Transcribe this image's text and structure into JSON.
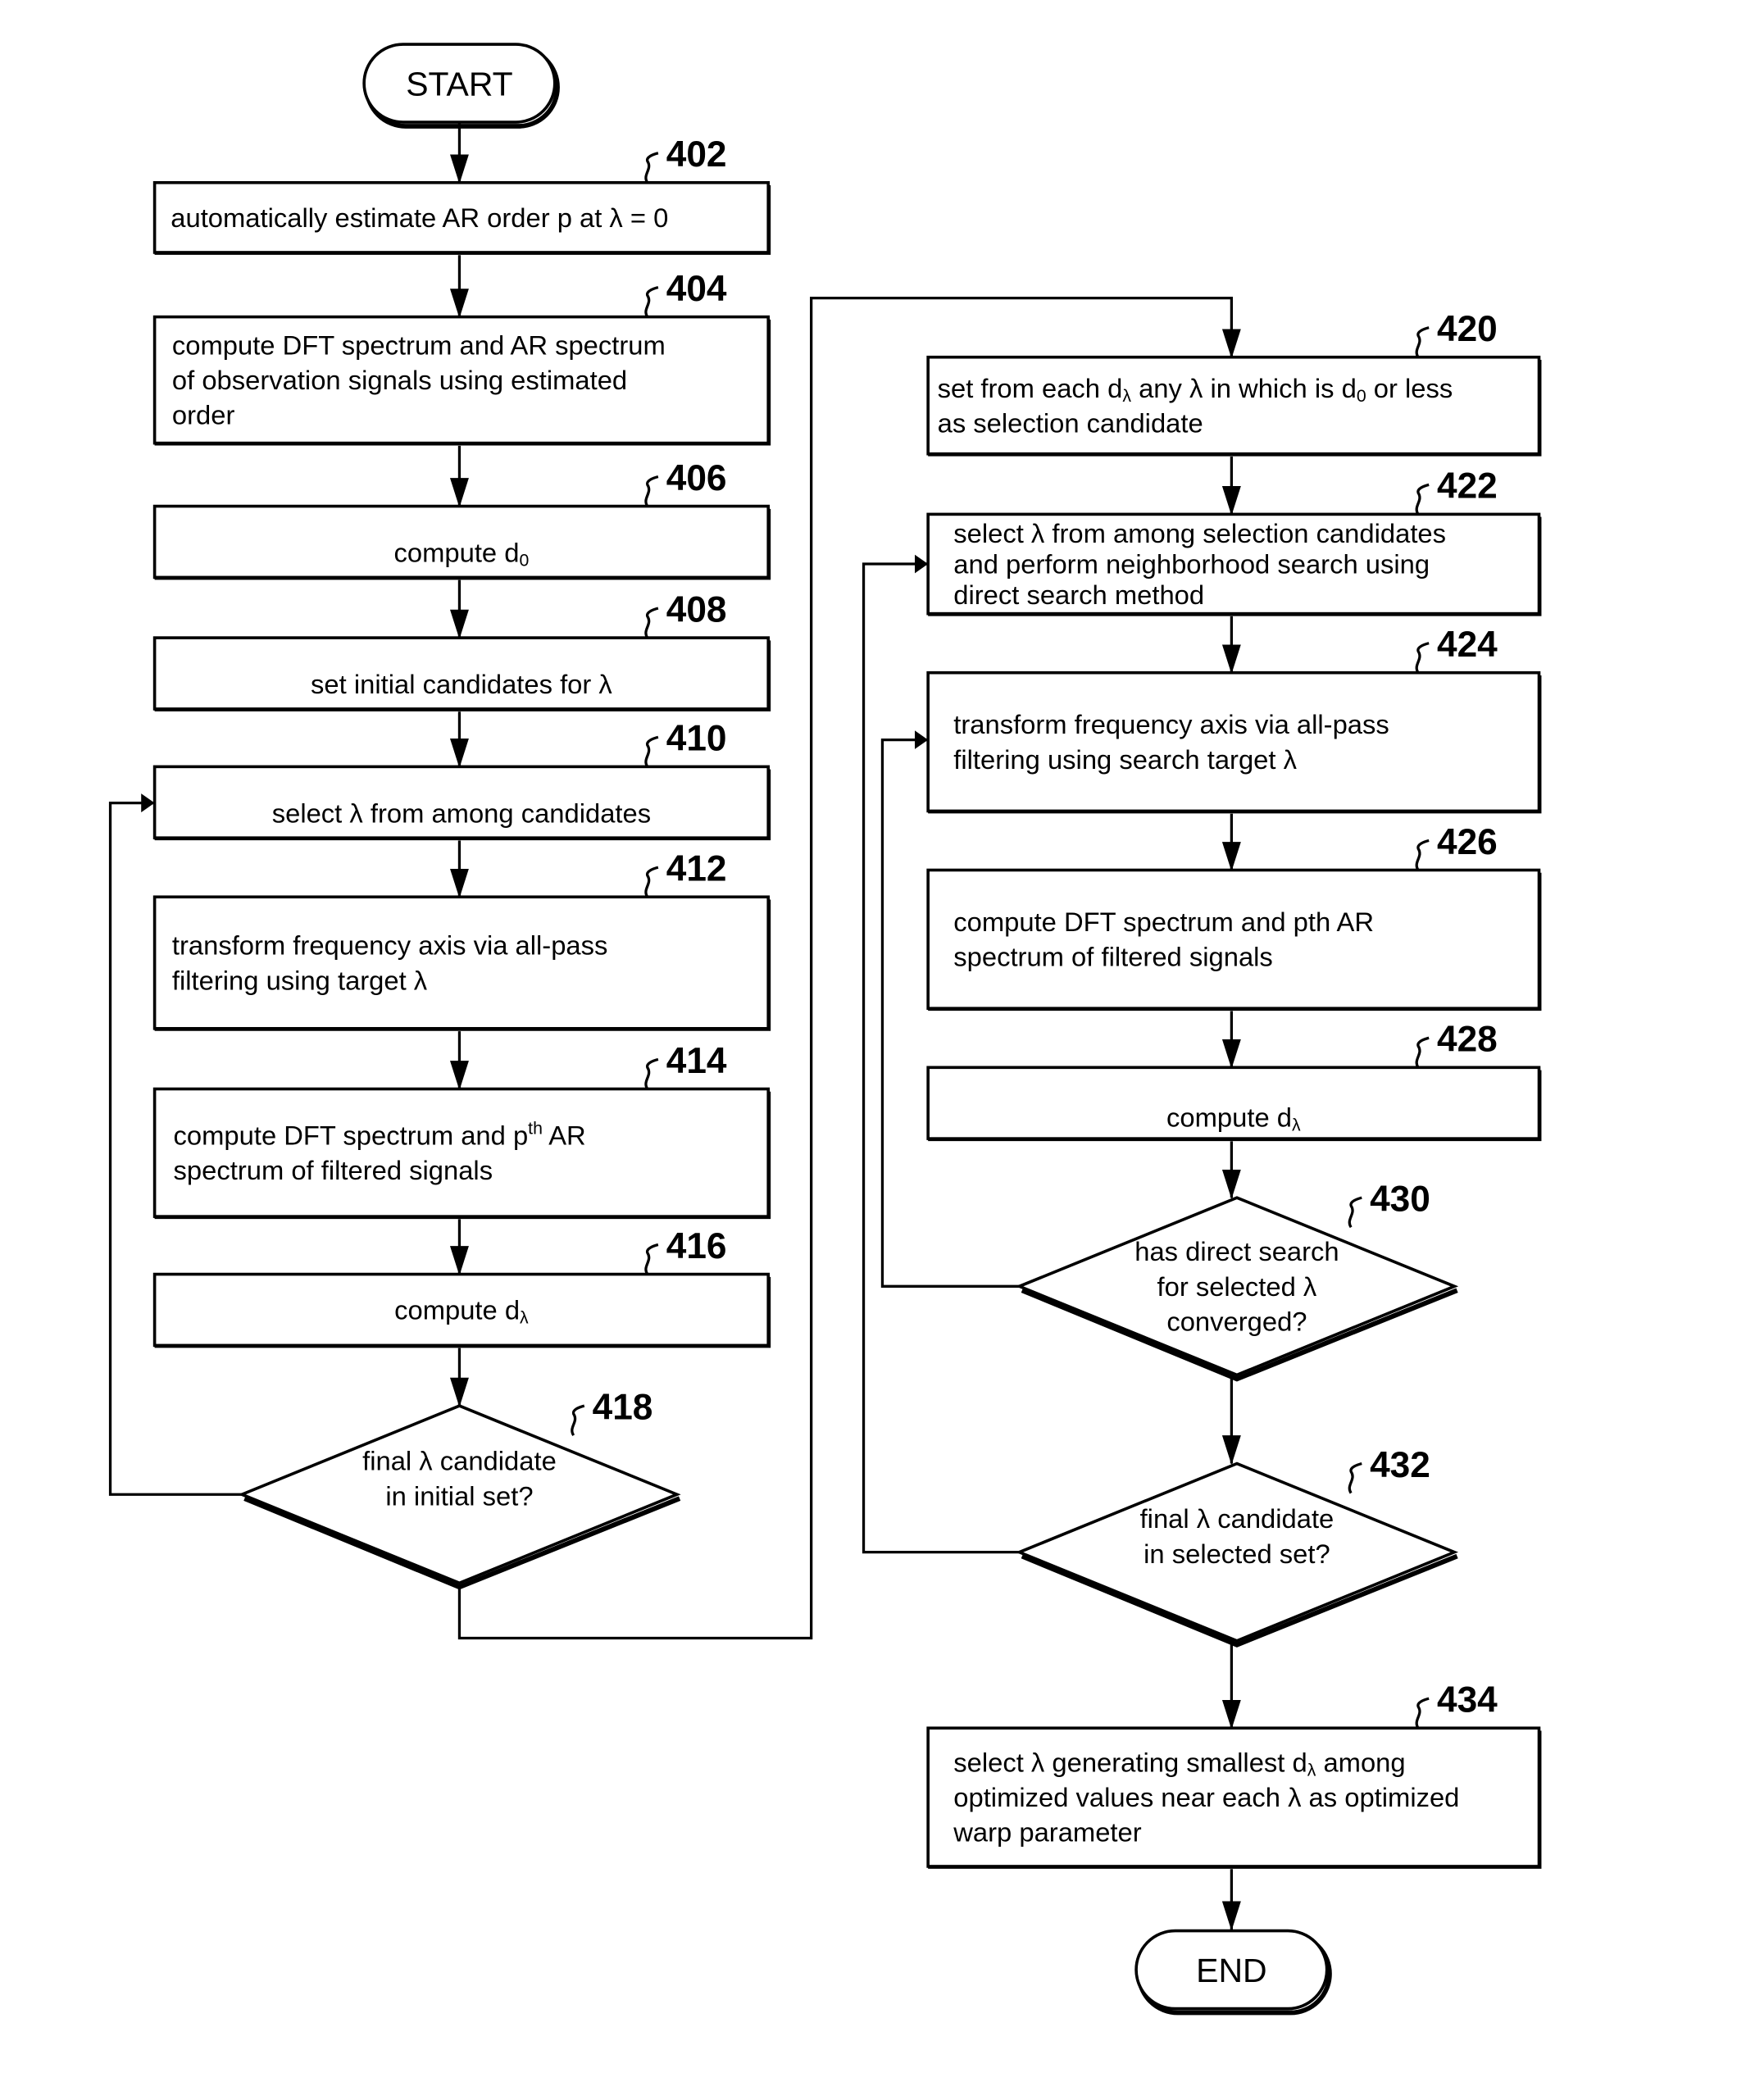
{
  "terminals": {
    "start": "START",
    "end": "END"
  },
  "steps": [
    {
      "id": "402",
      "ref": "402",
      "lines": [
        [
          "automatically estimate AR order p at λ = 0"
        ]
      ]
    },
    {
      "id": "404",
      "ref": "404",
      "lines": [
        [
          "compute DFT spectrum and AR spectrum"
        ],
        [
          "of observation signals using estimated"
        ],
        [
          "order"
        ]
      ]
    },
    {
      "id": "406",
      "ref": "406",
      "lines": [
        [
          "compute d",
          {
            "sub": "0"
          }
        ]
      ]
    },
    {
      "id": "408",
      "ref": "408",
      "lines": [
        [
          "set initial candidates for λ"
        ]
      ]
    },
    {
      "id": "410",
      "ref": "410",
      "lines": [
        [
          "select λ from among candidates"
        ]
      ]
    },
    {
      "id": "412",
      "ref": "412",
      "lines": [
        [
          "transform frequency axis via all-pass"
        ],
        [
          "filtering using target λ"
        ]
      ]
    },
    {
      "id": "414",
      "ref": "414",
      "lines": [
        [
          "compute DFT spectrum and p",
          {
            "sup": "th"
          },
          " AR"
        ],
        [
          "spectrum of filtered signals"
        ]
      ]
    },
    {
      "id": "416",
      "ref": "416",
      "lines": [
        [
          "compute d",
          {
            "sub": "λ"
          }
        ]
      ]
    },
    {
      "id": "418",
      "ref": "418",
      "lines": [
        [
          "final λ candidate"
        ],
        [
          "in initial set?"
        ]
      ]
    },
    {
      "id": "420",
      "ref": "420",
      "lines": [
        [
          "set from each d",
          {
            "sub": "λ"
          },
          " any λ in which is d",
          {
            "sub": "0"
          },
          " or less"
        ],
        [
          "as selection candidate"
        ]
      ]
    },
    {
      "id": "422",
      "ref": "422",
      "lines": [
        [
          "select λ from among selection candidates"
        ],
        [
          "and perform neighborhood search using"
        ],
        [
          "direct search method"
        ]
      ]
    },
    {
      "id": "424",
      "ref": "424",
      "lines": [
        [
          "transform frequency axis via all-pass"
        ],
        [
          "filtering using search target λ"
        ]
      ]
    },
    {
      "id": "426",
      "ref": "426",
      "lines": [
        [
          "compute DFT spectrum and pth AR"
        ],
        [
          "spectrum of filtered signals"
        ]
      ]
    },
    {
      "id": "428",
      "ref": "428",
      "lines": [
        [
          "compute d",
          {
            "sub": "λ"
          }
        ]
      ]
    },
    {
      "id": "430",
      "ref": "430",
      "lines": [
        [
          "has direct search"
        ],
        [
          "for selected λ"
        ],
        [
          "converged?"
        ]
      ]
    },
    {
      "id": "432",
      "ref": "432",
      "lines": [
        [
          "final λ candidate"
        ],
        [
          "in selected set?"
        ]
      ]
    },
    {
      "id": "434",
      "ref": "434",
      "lines": [
        [
          "select λ generating smallest d",
          {
            "sub": "λ"
          },
          " among"
        ],
        [
          "optimized values near each λ as optimized"
        ],
        [
          "warp parameter"
        ]
      ]
    }
  ]
}
